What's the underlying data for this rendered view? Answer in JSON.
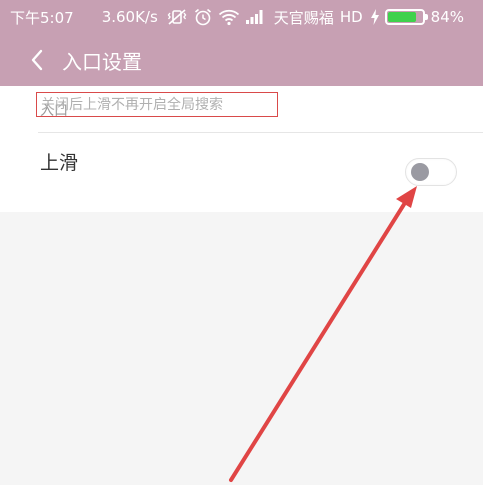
{
  "status_bar": {
    "time": "下午5:07",
    "speed": "3.60K/s",
    "carrier": "天官赐福",
    "network": "HD",
    "battery": "84%",
    "battery_level": 0.84
  },
  "toolbar": {
    "title": "入口设置"
  },
  "section": {
    "header": "入口"
  },
  "setting": {
    "title": "上滑",
    "description": "关闭后上滑不再开启全局搜索",
    "enabled": false
  },
  "colors": {
    "toolbar_bg": "#c7a0b3",
    "annotation": "#e04545",
    "battery_fill": "#3fd14c"
  }
}
